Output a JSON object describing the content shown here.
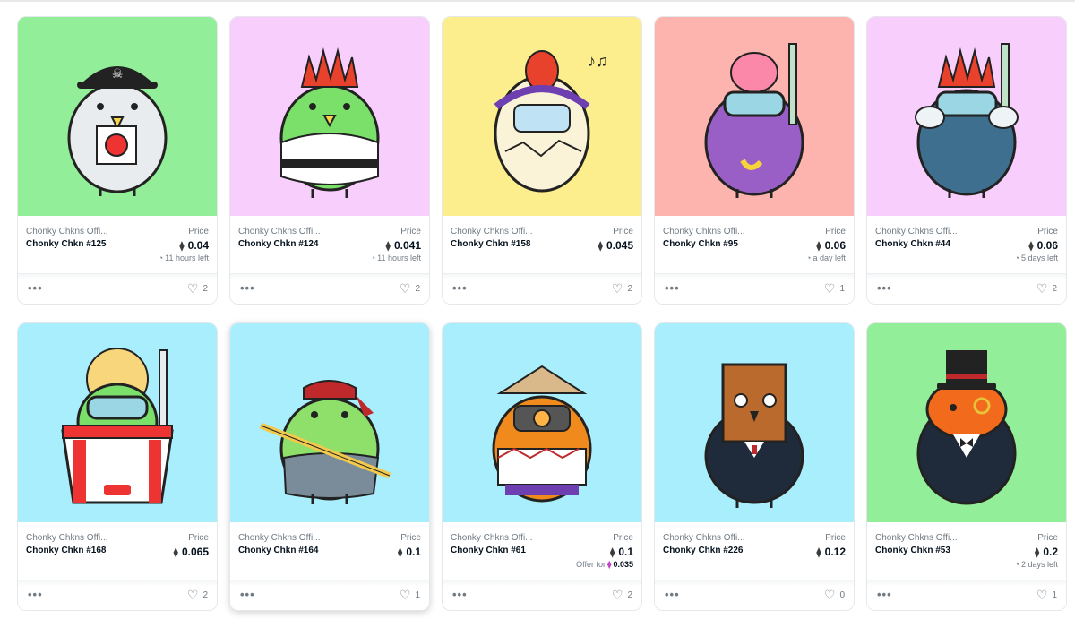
{
  "cards": [
    {
      "collection": "Chonky Chkns Offi...",
      "name": "Chonky Chkn #125",
      "price_label": "Price",
      "price": "0.04",
      "sub": "11 hours left",
      "likes": "2",
      "bg": "#93ee99"
    },
    {
      "collection": "Chonky Chkns Offi...",
      "name": "Chonky Chkn #124",
      "price_label": "Price",
      "price": "0.041",
      "sub": "11 hours left",
      "likes": "2",
      "bg": "#f8cffc"
    },
    {
      "collection": "Chonky Chkns Offi...",
      "name": "Chonky Chkn #158",
      "price_label": "Price",
      "price": "0.045",
      "sub": "",
      "likes": "2",
      "bg": "#fcee8c"
    },
    {
      "collection": "Chonky Chkns Offi...",
      "name": "Chonky Chkn #95",
      "price_label": "Price",
      "price": "0.06",
      "sub": "a day left",
      "likes": "1",
      "bg": "#fdb4ae"
    },
    {
      "collection": "Chonky Chkns Offi...",
      "name": "Chonky Chkn #44",
      "price_label": "Price",
      "price": "0.06",
      "sub": "5 days left",
      "likes": "2",
      "bg": "#f8cffc"
    },
    {
      "collection": "Chonky Chkns Offi...",
      "name": "Chonky Chkn #168",
      "price_label": "Price",
      "price": "0.065",
      "sub": "",
      "likes": "2",
      "bg": "#a9eefc"
    },
    {
      "collection": "Chonky Chkns Offi...",
      "name": "Chonky Chkn #164",
      "price_label": "Price",
      "price": "0.1",
      "sub": "",
      "likes": "1",
      "bg": "#a9eefc"
    },
    {
      "collection": "Chonky Chkns Offi...",
      "name": "Chonky Chkn #61",
      "price_label": "Price",
      "price": "0.1",
      "offer_label": "Offer for",
      "offer": "0.035",
      "likes": "2",
      "bg": "#a9eefc"
    },
    {
      "collection": "Chonky Chkns Offi...",
      "name": "Chonky Chkn #226",
      "price_label": "Price",
      "price": "0.12",
      "sub": "",
      "likes": "0",
      "bg": "#a9eefc"
    },
    {
      "collection": "Chonky Chkns Offi...",
      "name": "Chonky Chkn #53",
      "price_label": "Price",
      "price": "0.2",
      "sub": "2 days left",
      "likes": "1",
      "bg": "#93ee99"
    }
  ],
  "icons": {
    "currency": "ethereum-icon",
    "timer": "clock-icon",
    "like": "heart-icon",
    "menu": "more-options-icon"
  }
}
